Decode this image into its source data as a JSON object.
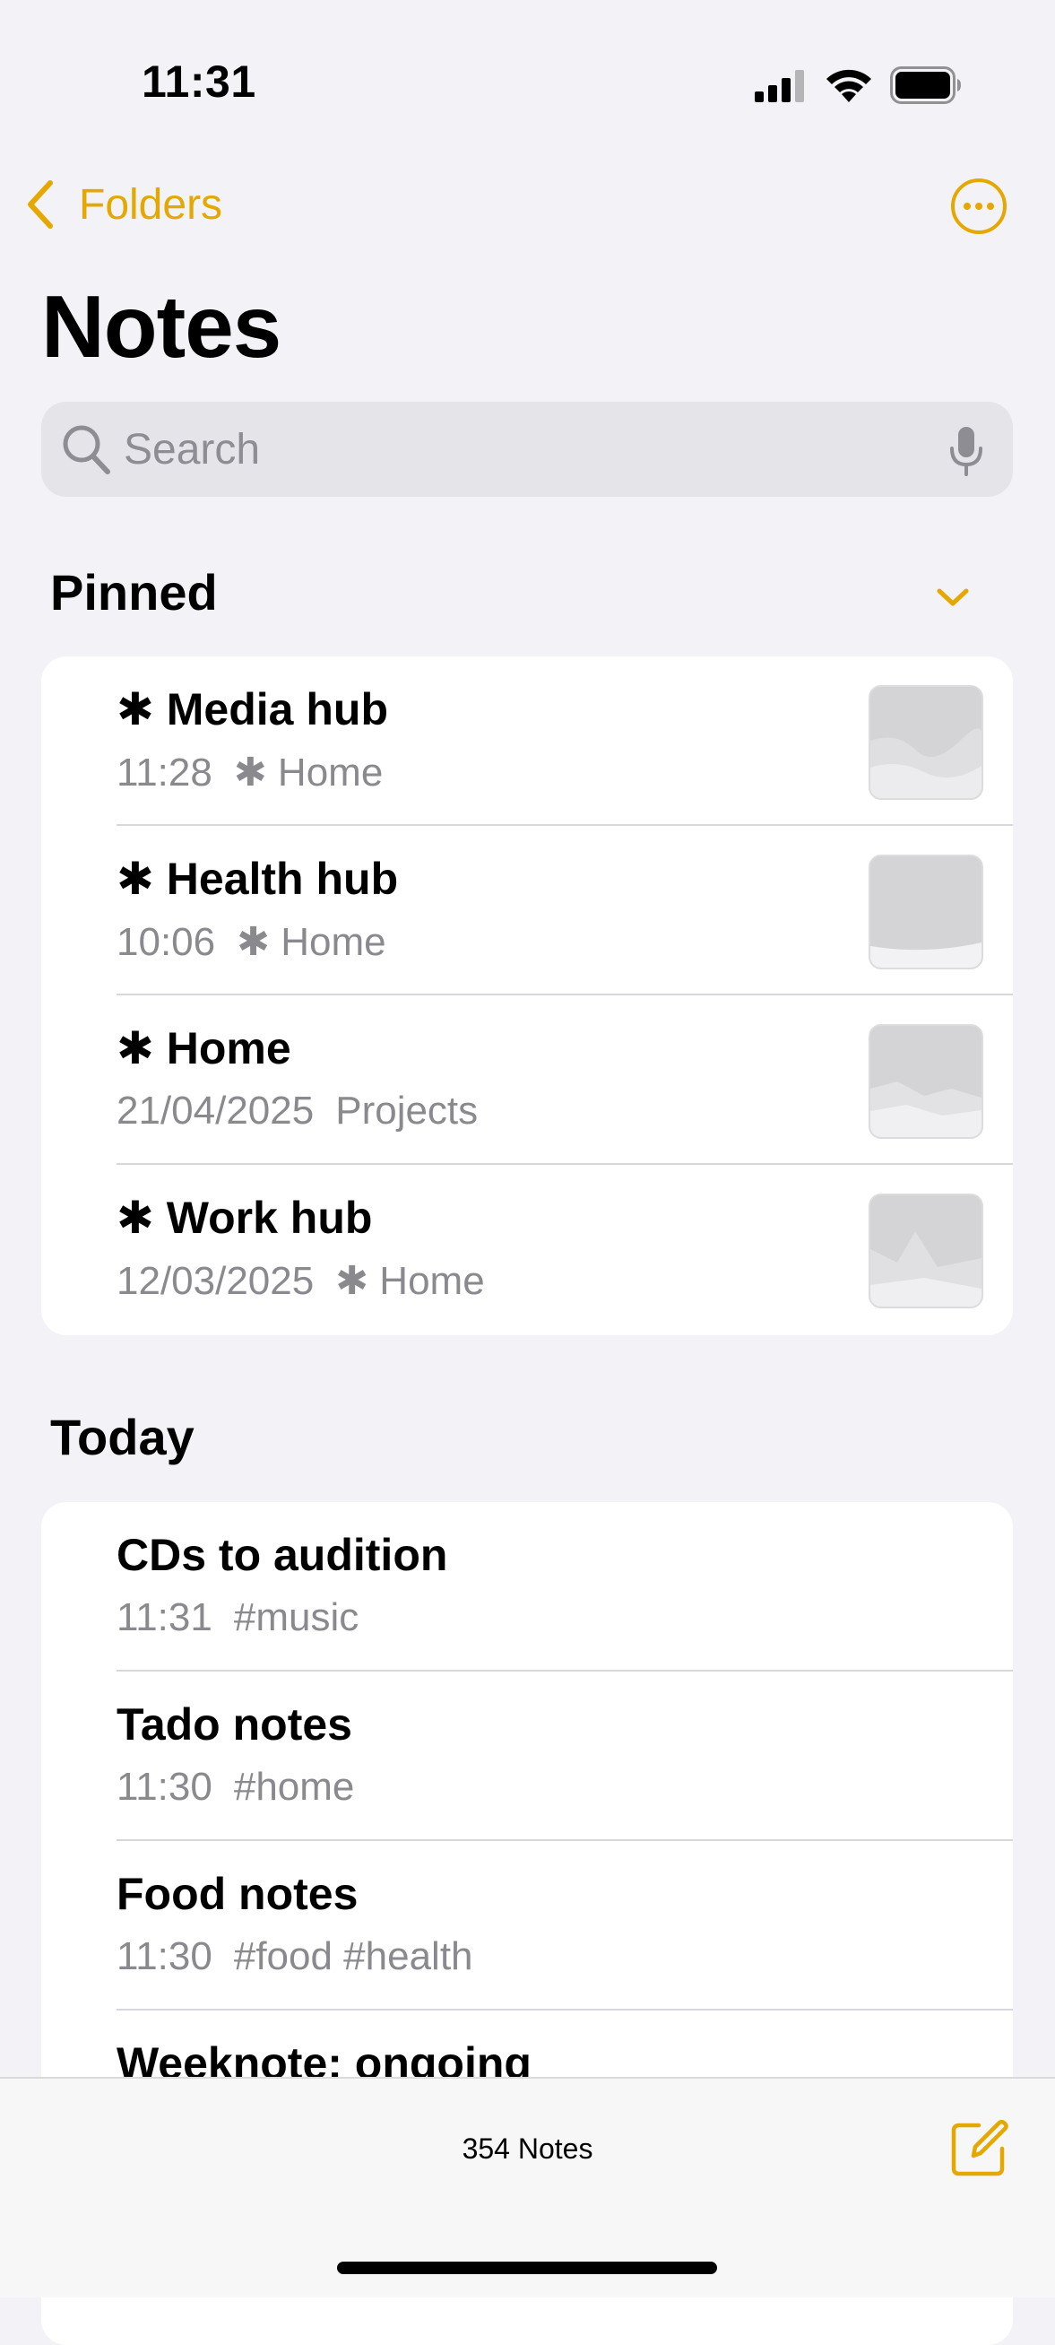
{
  "status_bar": {
    "time": "11:31"
  },
  "nav": {
    "back_label": "Folders",
    "accent_color": "#e5a800"
  },
  "page": {
    "title": "Notes"
  },
  "search": {
    "placeholder": "Search",
    "value": ""
  },
  "sections": {
    "pinned": {
      "heading": "Pinned",
      "notes": [
        {
          "title": "✱ Media hub",
          "date": "11:28",
          "folder": "✱ Home"
        },
        {
          "title": "✱ Health hub",
          "date": "10:06",
          "folder": "✱ Home"
        },
        {
          "title": "✱ Home",
          "date": "21/04/2025",
          "folder": "Projects"
        },
        {
          "title": "✱ Work hub",
          "date": "12/03/2025",
          "folder": "✱ Home"
        }
      ]
    },
    "today": {
      "heading": "Today",
      "notes": [
        {
          "title": "CDs to audition",
          "date": "11:31",
          "tags": "#music"
        },
        {
          "title": "Tado notes",
          "date": "11:30",
          "tags": "#home"
        },
        {
          "title": "Food notes",
          "date": "11:30",
          "tags": "#food #health"
        },
        {
          "title": "Weeknote: ongoing",
          "date": "",
          "tags": ""
        }
      ]
    }
  },
  "toolbar": {
    "count_label": "354 Notes"
  },
  "icons": {
    "back": "chevron-left-icon",
    "more": "ellipsis-circle-icon",
    "search": "magnifying-glass-icon",
    "mic": "microphone-icon",
    "collapse": "chevron-down-icon",
    "compose": "compose-icon"
  }
}
